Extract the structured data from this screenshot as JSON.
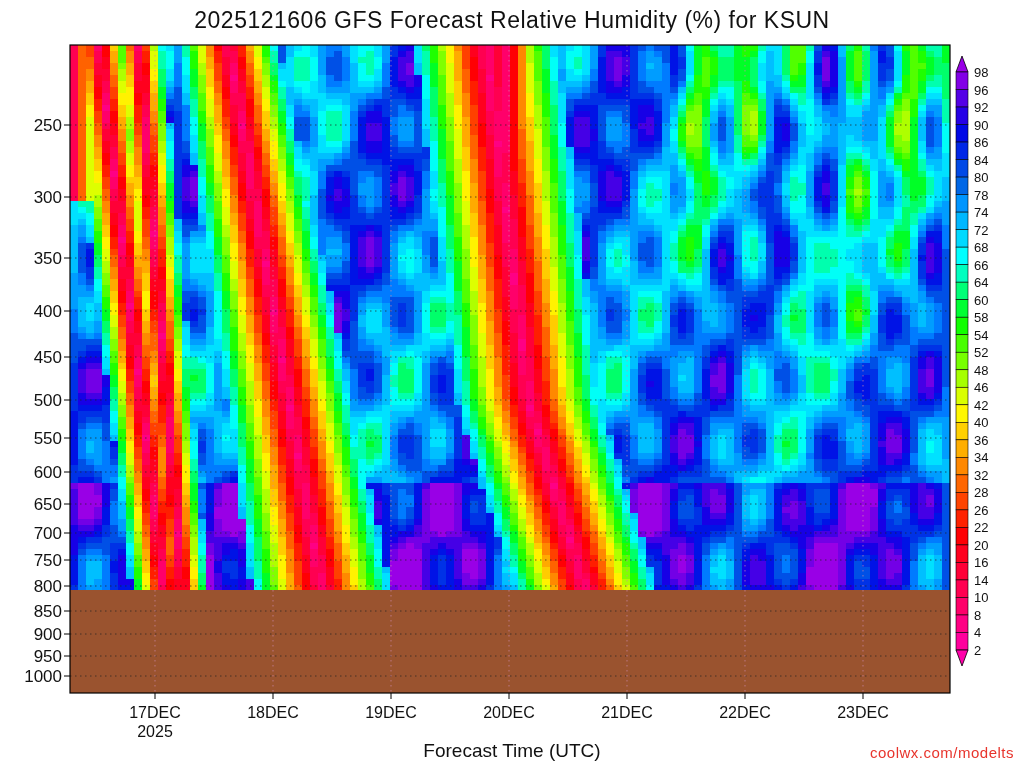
{
  "title": "2025121606 GFS Forecast Relative Humidity (%) for KSUN",
  "chart": {
    "y_ticks": [
      "250",
      "300",
      "350",
      "400",
      "450",
      "500",
      "550",
      "600",
      "650",
      "700",
      "750",
      "800",
      "850",
      "900",
      "950",
      "1000"
    ],
    "x_ticks": [
      "17DEC",
      "18DEC",
      "19DEC",
      "20DEC",
      "21DEC",
      "22DEC",
      "23DEC"
    ],
    "year_label": "2025",
    "xlabel": "Forecast Time (UTC)"
  },
  "color_scale": {
    "labels": [
      "98",
      "96",
      "92",
      "90",
      "86",
      "84",
      "80",
      "78",
      "74",
      "72",
      "68",
      "66",
      "64",
      "60",
      "58",
      "54",
      "52",
      "48",
      "46",
      "42",
      "40",
      "36",
      "34",
      "32",
      "28",
      "26",
      "22",
      "20",
      "16",
      "14",
      "10",
      "8",
      "4",
      "2"
    ]
  },
  "credit": "coolwx.com/modelts"
}
